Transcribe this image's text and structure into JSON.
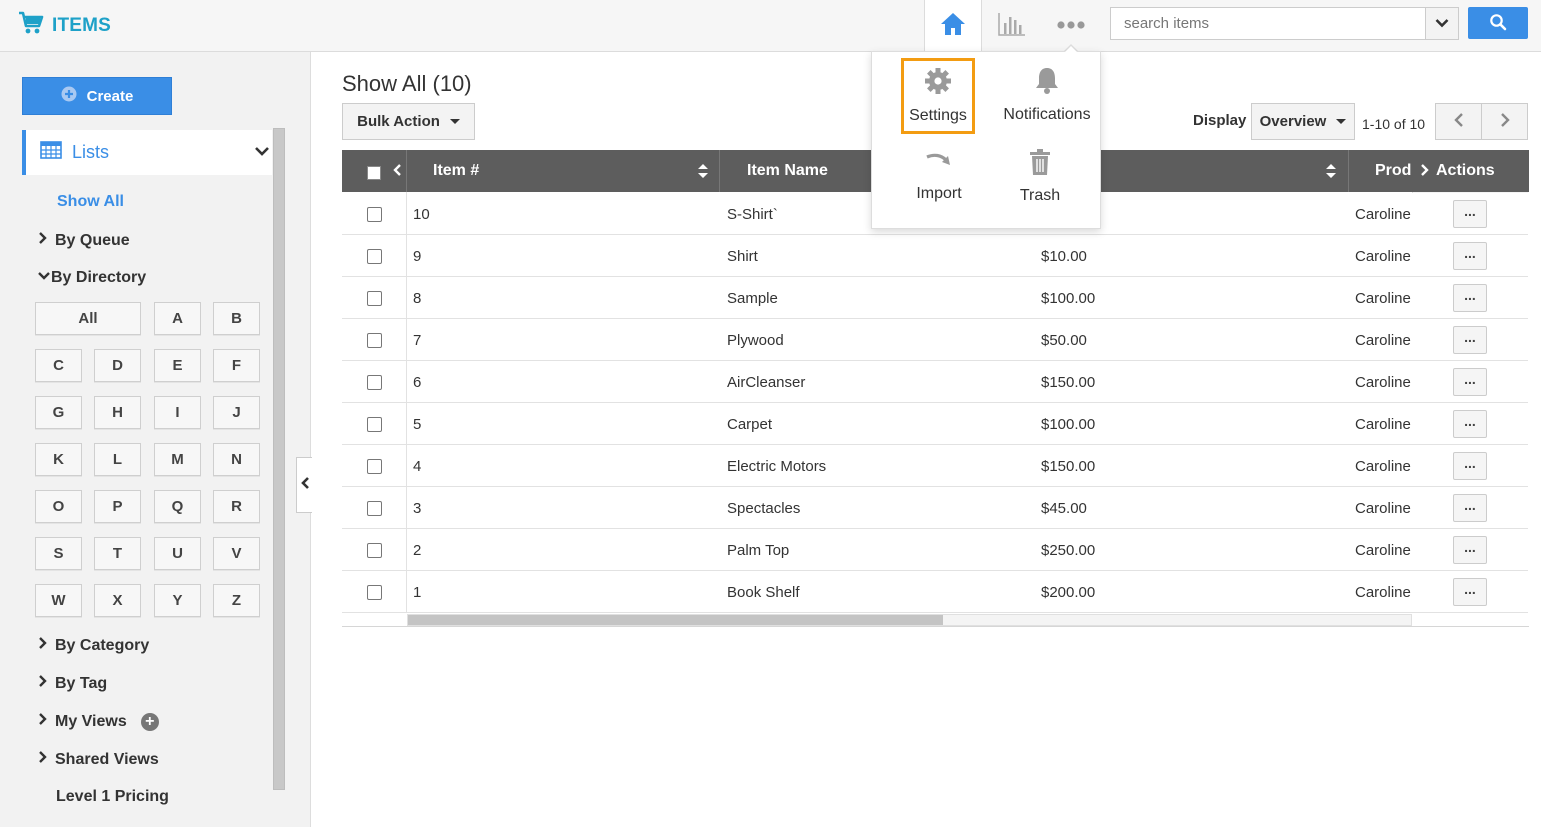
{
  "app": {
    "title": "ITEMS",
    "accent": "#3a8ee6",
    "brand_color": "#1ea1c8"
  },
  "header": {
    "search_placeholder": "search items",
    "nav": [
      "home-icon",
      "chart-icon",
      "more-icon"
    ]
  },
  "menu": {
    "items": [
      {
        "label": "Settings",
        "icon": "gear-icon",
        "highlighted": true
      },
      {
        "label": "Notifications",
        "icon": "bell-icon"
      },
      {
        "label": "Import",
        "icon": "import-arrow-icon"
      },
      {
        "label": "Trash",
        "icon": "trash-icon"
      }
    ]
  },
  "sidebar": {
    "create_label": "Create",
    "lists_label": "Lists",
    "show_all": "Show All",
    "by_queue": "By Queue",
    "by_directory": "By Directory",
    "letters": [
      "All",
      "A",
      "B",
      "C",
      "D",
      "E",
      "F",
      "G",
      "H",
      "I",
      "J",
      "K",
      "L",
      "M",
      "N",
      "O",
      "P",
      "Q",
      "R",
      "S",
      "T",
      "U",
      "V",
      "W",
      "X",
      "Y",
      "Z"
    ],
    "by_category": "By Category",
    "by_tag": "By Tag",
    "my_views": "My Views",
    "shared_views": "Shared Views",
    "level_pricing": "Level 1 Pricing"
  },
  "main": {
    "title": "Show All (10)",
    "bulk_action": "Bulk Action",
    "display_label": "Display",
    "display_value": "Overview",
    "pager": "1-10 of 10"
  },
  "table": {
    "headers": {
      "item_no": "Item #",
      "item_name": "Item Name",
      "prod": "Prod",
      "actions": "Actions"
    },
    "rows": [
      {
        "no": "10",
        "name": "S-Shirt`",
        "price": "",
        "owner": "Caroline"
      },
      {
        "no": "9",
        "name": "Shirt",
        "price": "$10.00",
        "owner": "Caroline"
      },
      {
        "no": "8",
        "name": "Sample",
        "price": "$100.00",
        "owner": "Caroline"
      },
      {
        "no": "7",
        "name": "Plywood",
        "price": "$50.00",
        "owner": "Caroline"
      },
      {
        "no": "6",
        "name": "AirCleanser",
        "price": "$150.00",
        "owner": "Caroline"
      },
      {
        "no": "5",
        "name": "Carpet",
        "price": "$100.00",
        "owner": "Caroline"
      },
      {
        "no": "4",
        "name": "Electric Motors",
        "price": "$150.00",
        "owner": "Caroline"
      },
      {
        "no": "3",
        "name": "Spectacles",
        "price": "$45.00",
        "owner": "Caroline"
      },
      {
        "no": "2",
        "name": "Palm Top",
        "price": "$250.00",
        "owner": "Caroline"
      },
      {
        "no": "1",
        "name": "Book Shelf",
        "price": "$200.00",
        "owner": "Caroline"
      }
    ],
    "action_glyph": "..."
  }
}
